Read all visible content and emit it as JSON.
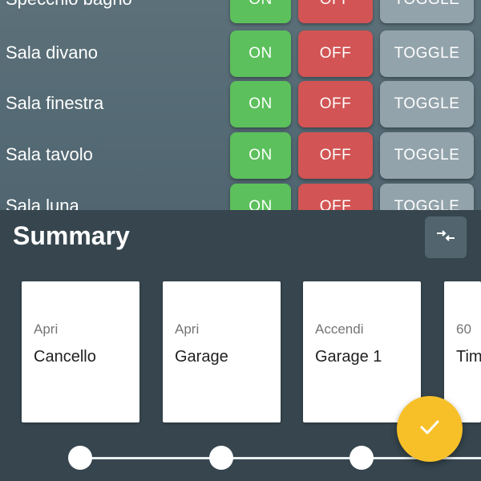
{
  "devices": [
    {
      "name": "Specchio bagno",
      "on_label": "ON",
      "off_label": "OFF",
      "toggle_label": "TOGGLE"
    },
    {
      "name": "Sala divano",
      "on_label": "ON",
      "off_label": "OFF",
      "toggle_label": "TOGGLE"
    },
    {
      "name": "Sala finestra",
      "on_label": "ON",
      "off_label": "OFF",
      "toggle_label": "TOGGLE"
    },
    {
      "name": "Sala tavolo",
      "on_label": "ON",
      "off_label": "OFF",
      "toggle_label": "TOGGLE"
    },
    {
      "name": "Sala luna",
      "on_label": "ON",
      "off_label": "OFF",
      "toggle_label": "TOGGLE"
    }
  ],
  "summary": {
    "title": "Summary",
    "collapse_icon": "collapse-arrows-icon",
    "cards": [
      {
        "action": "Apri",
        "target": "Cancello"
      },
      {
        "action": "Apri",
        "target": "Garage"
      },
      {
        "action": "Accendi",
        "target": "Garage 1"
      },
      {
        "action": "60",
        "target": "Timer"
      }
    ],
    "confirm_icon": "check-icon"
  },
  "colors": {
    "on": "#5cc05c",
    "off": "#d25454",
    "toggle": "#93a3ab",
    "sheet": "#36454e",
    "fab": "#f8c028"
  }
}
